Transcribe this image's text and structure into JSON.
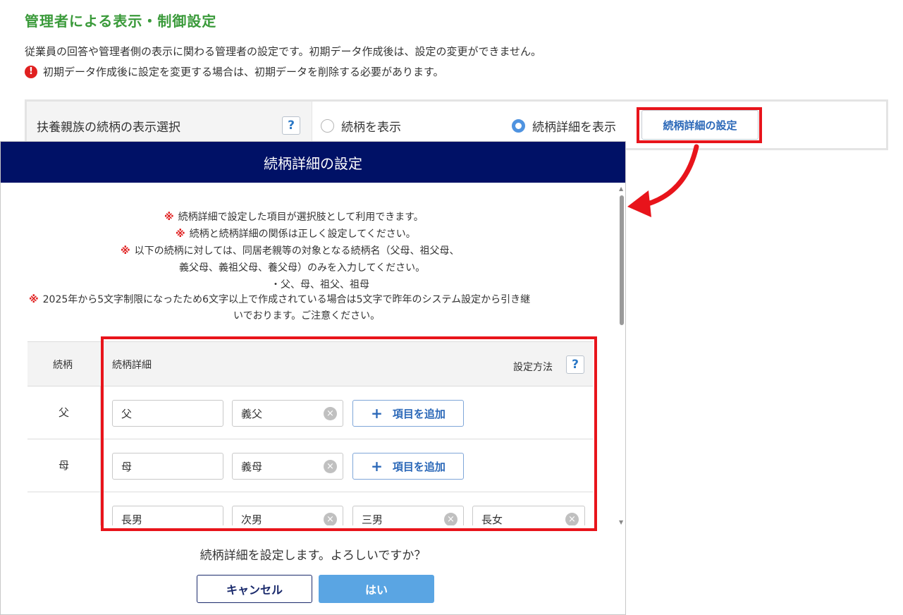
{
  "page": {
    "title": "管理者による表示・制御設定",
    "description": "従業員の回答や管理者側の表示に関わる管理者の設定です。初期データ作成後は、設定の変更ができません。",
    "warning_icon": "!",
    "warning": "初期データ作成後に設定を変更する場合は、初期データを削除する必要があります。"
  },
  "setting": {
    "label": "扶養親族の続柄の表示選択",
    "help": "?",
    "option_relation": "続柄を表示",
    "option_detail": "続柄詳細を表示",
    "selected": "続柄詳細を表示",
    "detail_button": "続柄詳細の設定"
  },
  "modal": {
    "title": "続柄詳細の設定",
    "mark": "※",
    "notes": [
      "続柄詳細で設定した項目が選択肢として利用できます。",
      "続柄と続柄詳細の関係は正しく設定してください。",
      "以下の続柄に対しては、同居老親等の対象となる続柄名（父母、祖父母、",
      "義父母、義祖父母、養父母）のみを入力してください。",
      "・父、母、祖父、祖母",
      "2025年から5文字制限になったため6文字以上で作成されている場合は5文字で昨年のシステム設定から引き継",
      "いでおります。ご注意ください。"
    ],
    "table": {
      "col_relation": "続柄",
      "col_detail": "続柄詳細",
      "setting_method": "設定方法",
      "help": "?",
      "add_label": "項目を追加",
      "add_icon": "+",
      "clear_icon": "×",
      "rows": [
        {
          "relation": "父",
          "details": [
            "父",
            "義父"
          ]
        },
        {
          "relation": "母",
          "details": [
            "母",
            "義母"
          ]
        },
        {
          "relation": "",
          "details": [
            "長男",
            "次男",
            "三男",
            "長女"
          ]
        }
      ]
    },
    "scroll_up": "▲",
    "scroll_down": "▼",
    "confirm": "続柄詳細を設定します。よろしいですか？",
    "cancel": "キャンセル",
    "ok": "はい"
  },
  "colors": {
    "title_green": "#3a9a3a",
    "modal_header": "#001166",
    "highlight_red": "#e8141b",
    "primary_blue": "#5aa5e3"
  }
}
